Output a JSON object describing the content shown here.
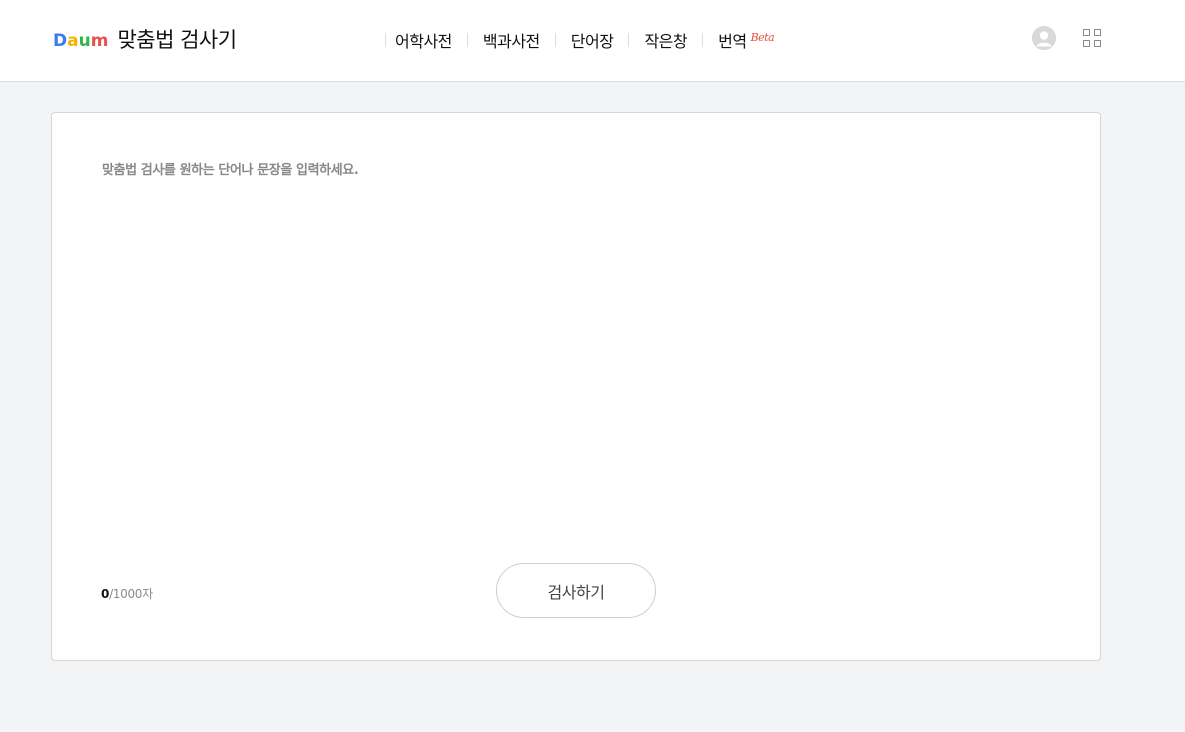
{
  "header": {
    "logo_letters": [
      "D",
      "a",
      "u",
      "m"
    ],
    "logo_colors": [
      "#3a7bf0",
      "#f5b400",
      "#35b24a",
      "#e8504d"
    ],
    "service_title": "맞춤법 검사기",
    "nav": [
      {
        "label": "어학사전"
      },
      {
        "label": "백과사전"
      },
      {
        "label": "단어장"
      },
      {
        "label": "작은창"
      },
      {
        "label": "번역",
        "badge": "Beta"
      }
    ],
    "icons": {
      "profile": "user-avatar-icon",
      "apps": "app-grid-icon"
    }
  },
  "editor": {
    "placeholder": "맞춤법 검사를 원하는 단어나 문장을 입력하세요.",
    "value": ""
  },
  "counter": {
    "current": "0",
    "limit": "/1000자"
  },
  "actions": {
    "check_label": "검사하기"
  }
}
